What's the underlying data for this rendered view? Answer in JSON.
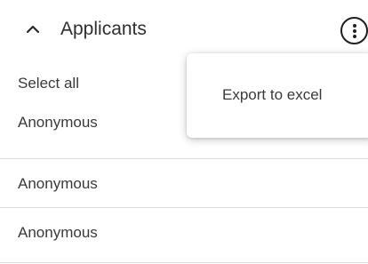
{
  "section": {
    "title": "Applicants",
    "expanded": true,
    "collapse_icon": "chevron-up-icon",
    "menu_icon": "kebab-menu-icon"
  },
  "list": {
    "select_all_label": "Select all",
    "items": [
      {
        "name": "Anonymous"
      },
      {
        "name": "Anonymous"
      },
      {
        "name": "Anonymous"
      }
    ]
  },
  "menu": {
    "items": [
      {
        "label": "Export to excel"
      }
    ]
  }
}
